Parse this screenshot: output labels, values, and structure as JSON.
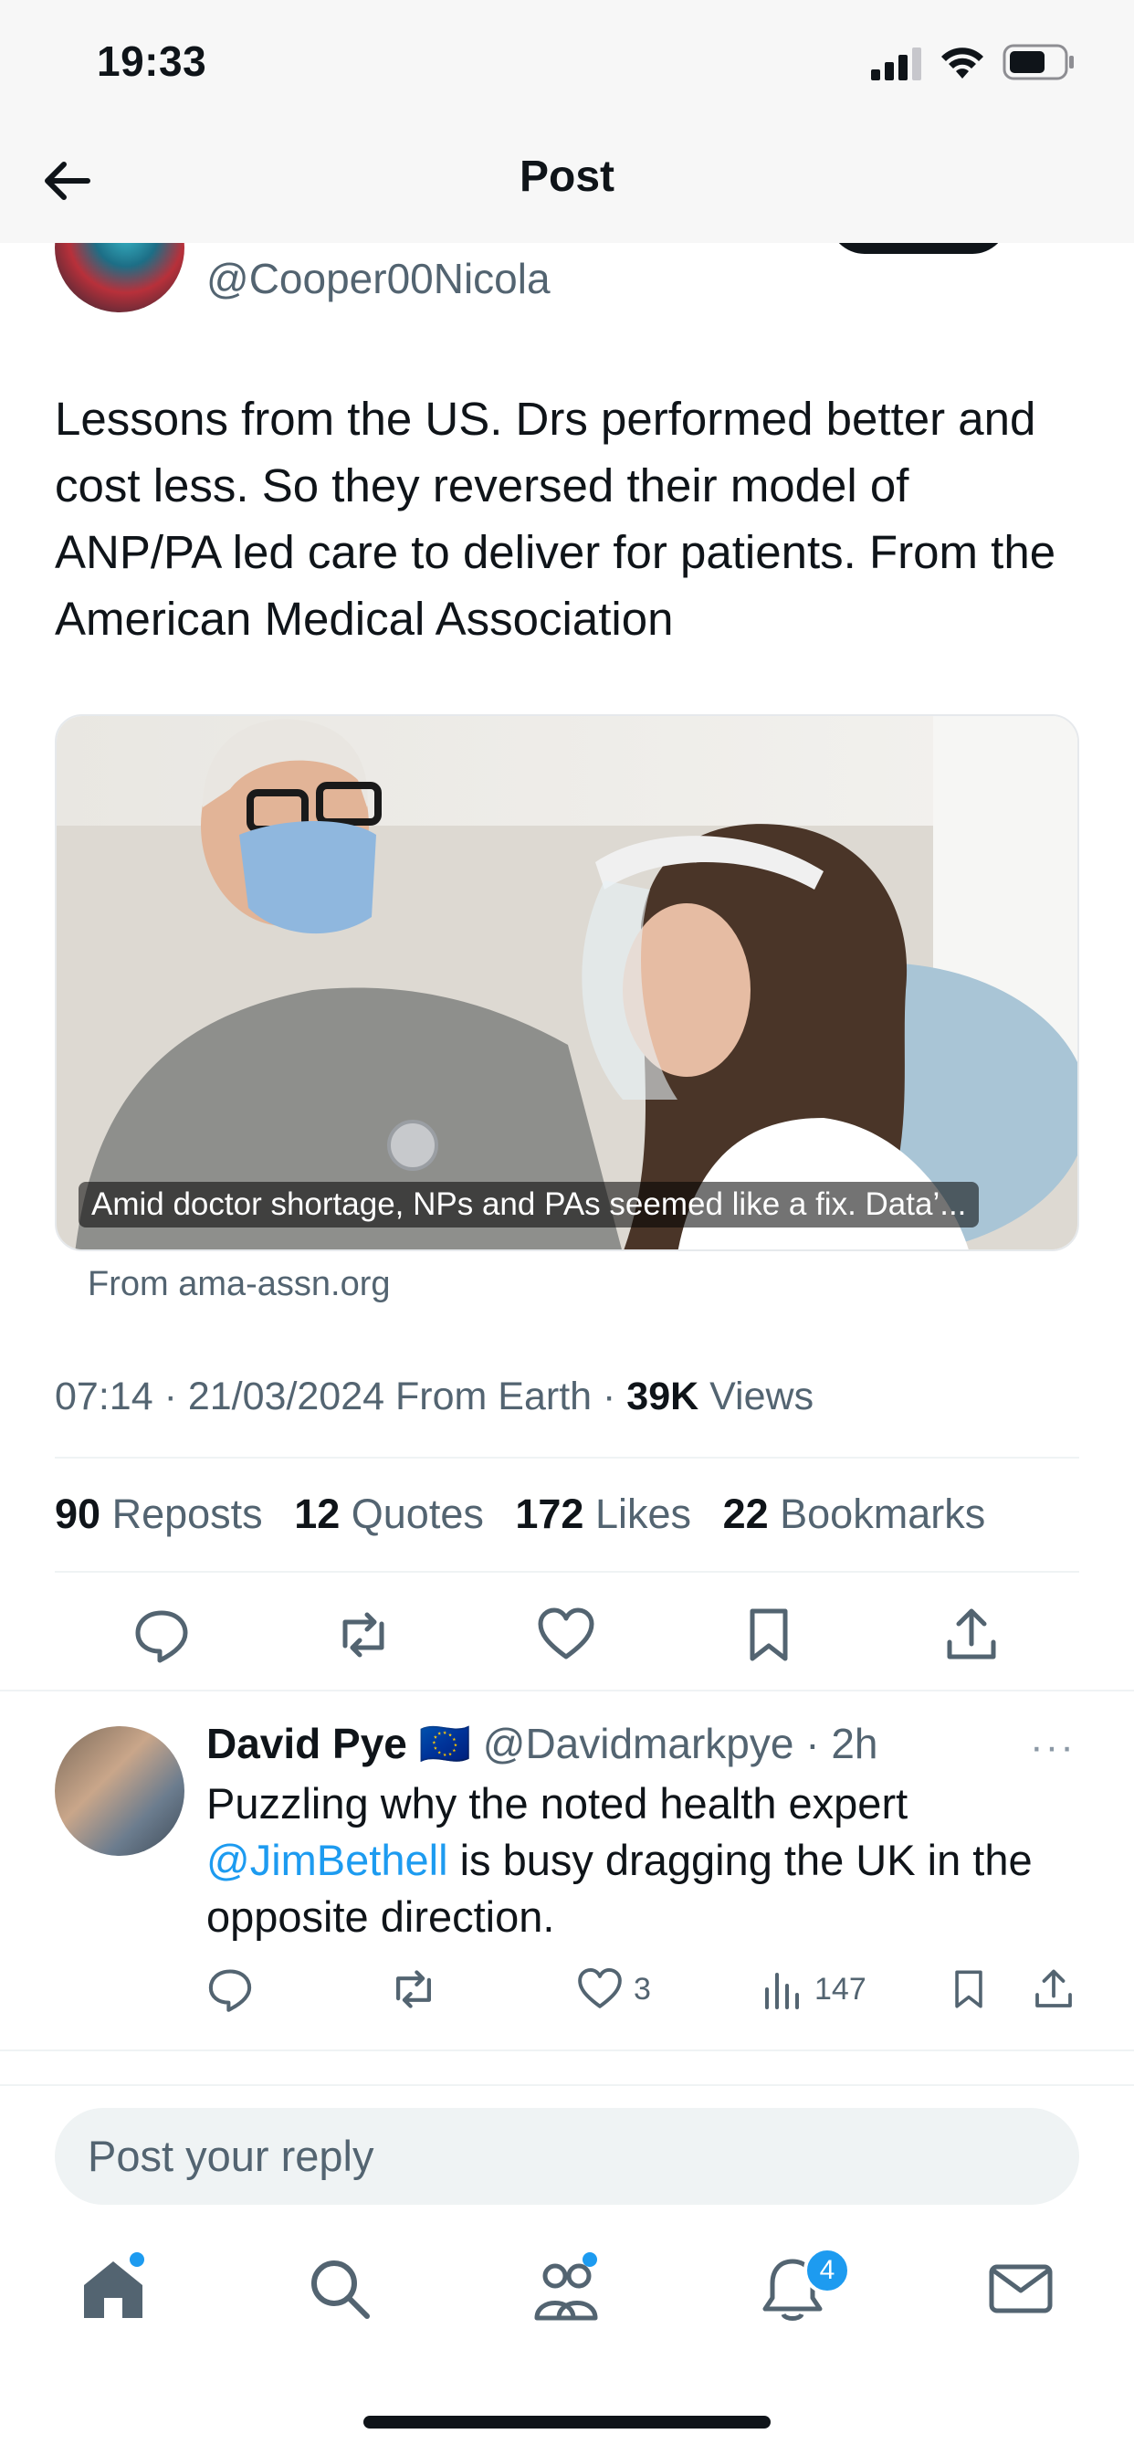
{
  "status_bar": {
    "time": "19:33"
  },
  "header": {
    "title": "Post"
  },
  "post": {
    "author_handle": "@Cooper00Nicola",
    "text": "Lessons from the US. Drs performed better and cost less. So they reversed their model of ANP/PA led care to deliver for patients. From the American Medical Association",
    "media": {
      "caption": "Amid doctor shortage, NPs and PAs seemed like a fix. Data’...",
      "source": "From ama-assn.org"
    },
    "meta": {
      "time": "07:14",
      "date": "21/03/2024",
      "location": "From Earth",
      "views_count": "39K",
      "views_label": "Views",
      "separator": "·"
    },
    "stats": [
      {
        "count": "90",
        "label": "Reposts"
      },
      {
        "count": "12",
        "label": "Quotes"
      },
      {
        "count": "172",
        "label": "Likes"
      },
      {
        "count": "22",
        "label": "Bookmarks"
      }
    ]
  },
  "reply": {
    "name": "David Pye",
    "flag": "🇪🇺",
    "handle_time": "@Davidmarkpye · 2h",
    "text_before": "Puzzling why the noted health expert ",
    "mention": "@JimBethell",
    "text_after": " is busy dragging the UK in the opposite direction.",
    "likes": "3",
    "views": "147",
    "more": "···"
  },
  "composer": {
    "placeholder": "Post your reply"
  },
  "tab_bar": {
    "notifications_badge": "4"
  },
  "colors": {
    "accent": "#1d9bf0",
    "text": "#0f1419",
    "secondary": "#536471"
  },
  "icons": [
    "back-arrow-icon",
    "signal-icon",
    "wifi-icon",
    "battery-icon",
    "reply-icon",
    "repost-icon",
    "like-icon",
    "bookmark-icon",
    "share-icon",
    "views-icon",
    "more-icon",
    "home-icon",
    "search-icon",
    "communities-icon",
    "bell-icon",
    "mail-icon"
  ]
}
